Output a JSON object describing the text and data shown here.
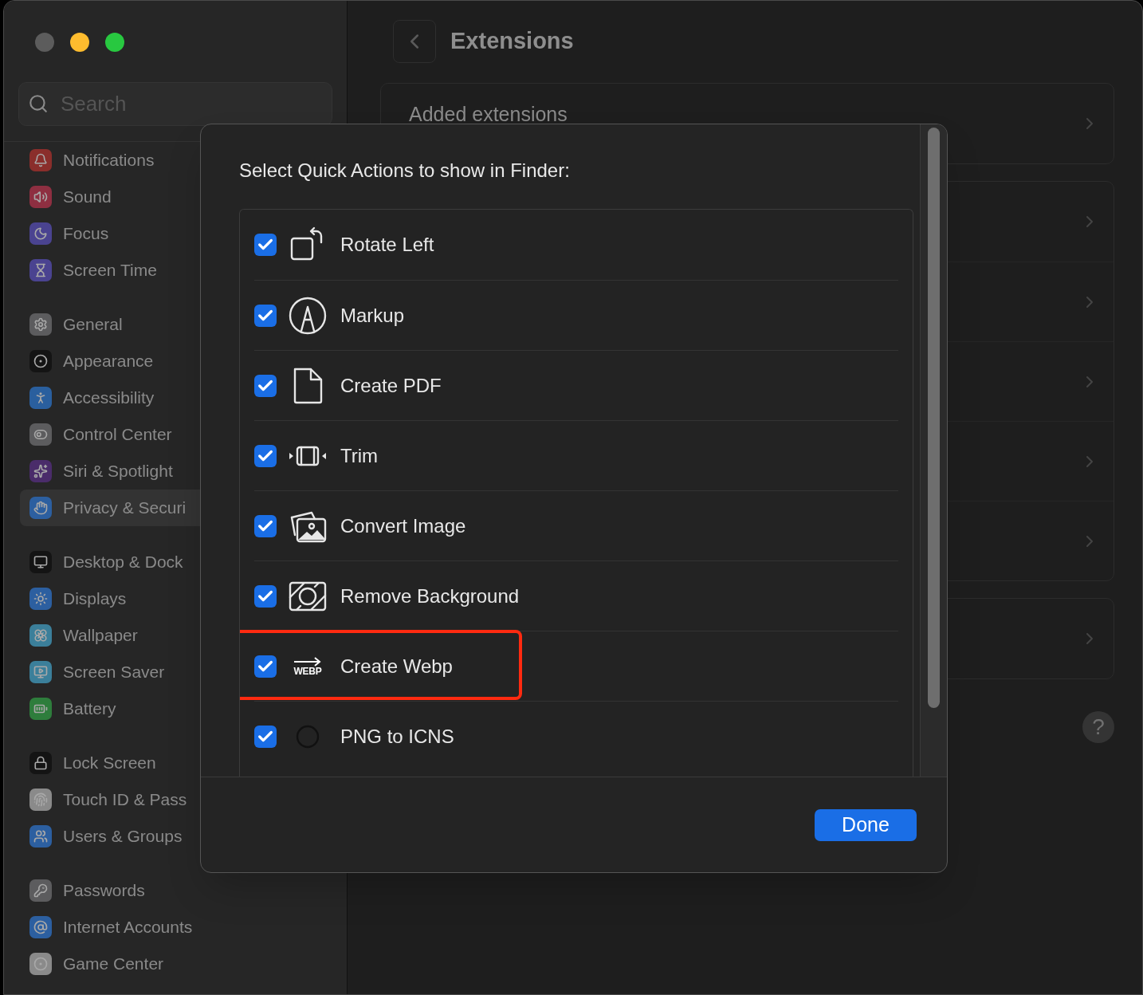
{
  "sidebar": {
    "search": {
      "placeholder": "Search"
    },
    "groups": [
      {
        "items": [
          {
            "label": "Notifications",
            "color": "#8a2e2b",
            "selected": false
          },
          {
            "label": "Sound",
            "color": "#8e2f41",
            "selected": false
          },
          {
            "label": "Focus",
            "color": "#4a4390",
            "selected": false
          },
          {
            "label": "Screen Time",
            "color": "#4a4390",
            "selected": false
          }
        ]
      },
      {
        "items": [
          {
            "label": "General",
            "color": "#5c5c5e",
            "selected": false
          },
          {
            "label": "Appearance",
            "color": "#141414",
            "selected": false
          },
          {
            "label": "Accessibility",
            "color": "#2a5f9e",
            "selected": false
          },
          {
            "label": "Control Center",
            "color": "#5c5c5e",
            "selected": false
          },
          {
            "label": "Siri & Spotlight",
            "color": "#4a2c6a",
            "selected": false
          },
          {
            "label": "Privacy & Securi",
            "color": "#2c5fa0",
            "selected": true
          }
        ]
      },
      {
        "items": [
          {
            "label": "Desktop & Dock",
            "color": "#141414",
            "selected": false
          },
          {
            "label": "Displays",
            "color": "#2c5fa0",
            "selected": false
          },
          {
            "label": "Wallpaper",
            "color": "#3b7f9a",
            "selected": false
          },
          {
            "label": "Screen Saver",
            "color": "#3b7f9a",
            "selected": false
          },
          {
            "label": "Battery",
            "color": "#2e7d3c",
            "selected": false
          }
        ]
      },
      {
        "items": [
          {
            "label": "Lock Screen",
            "color": "#141414",
            "selected": false
          },
          {
            "label": "Touch ID & Pass",
            "color": "#8a8a8a",
            "selected": false
          },
          {
            "label": "Users & Groups",
            "color": "#2c5fa0",
            "selected": false
          }
        ]
      },
      {
        "items": [
          {
            "label": "Passwords",
            "color": "#5c5c5e",
            "selected": false
          },
          {
            "label": "Internet Accounts",
            "color": "#2c5fa0",
            "selected": false
          },
          {
            "label": "Game Center",
            "color": "#8a8a8a",
            "selected": false
          }
        ]
      }
    ]
  },
  "main": {
    "title": "Extensions",
    "added_extensions": "Added extensions"
  },
  "dialog": {
    "title": "Select Quick Actions to show in Finder:",
    "actions": [
      {
        "label": "Rotate Left",
        "checked": true,
        "highlighted": false
      },
      {
        "label": "Markup",
        "checked": true,
        "highlighted": false
      },
      {
        "label": "Create PDF",
        "checked": true,
        "highlighted": false
      },
      {
        "label": "Trim",
        "checked": true,
        "highlighted": false
      },
      {
        "label": "Convert Image",
        "checked": true,
        "highlighted": false
      },
      {
        "label": "Remove Background",
        "checked": true,
        "highlighted": false
      },
      {
        "label": "Create Webp",
        "checked": true,
        "highlighted": true,
        "icon_label": "WEBP"
      },
      {
        "label": "PNG to ICNS",
        "checked": true,
        "highlighted": false
      }
    ],
    "done_button": "Done"
  },
  "help_button": "?"
}
